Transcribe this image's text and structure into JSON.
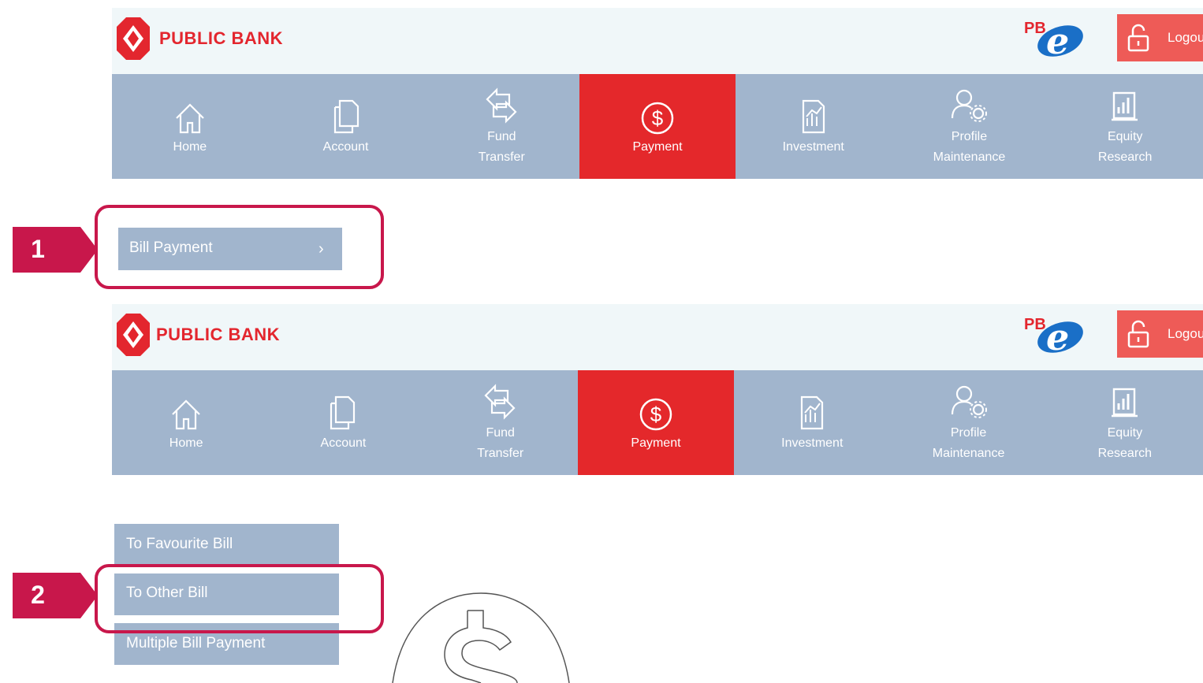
{
  "brand": {
    "name": "PUBLIC BANK",
    "pbe_text": "PB",
    "logout_label": "Logout"
  },
  "nav": [
    {
      "line1": "Home",
      "line2": "",
      "icon": "home-icon"
    },
    {
      "line1": "Account",
      "line2": "",
      "icon": "account-icon"
    },
    {
      "line1": "Fund",
      "line2": "Transfer",
      "icon": "fund-transfer-icon"
    },
    {
      "line1": "Payment",
      "line2": "",
      "icon": "payment-dollar-icon",
      "active": true
    },
    {
      "line1": "Investment",
      "line2": "",
      "icon": "investment-icon"
    },
    {
      "line1": "Profile",
      "line2": "Maintenance",
      "icon": "profile-icon"
    },
    {
      "line1": "Equity",
      "line2": "Research",
      "icon": "equity-research-icon"
    }
  ],
  "step1": {
    "number": "1",
    "bill_payment_label": "Bill Payment",
    "chevron": "›"
  },
  "step2": {
    "number": "2",
    "submenu": [
      "To Favourite Bill",
      "To Other Bill",
      "Multiple Bill Payment"
    ]
  },
  "colors": {
    "nav_bg": "#a1b5cd",
    "active_bg": "#e4282b",
    "highlight": "#c8174b",
    "logout_bg": "#ee5b57"
  }
}
